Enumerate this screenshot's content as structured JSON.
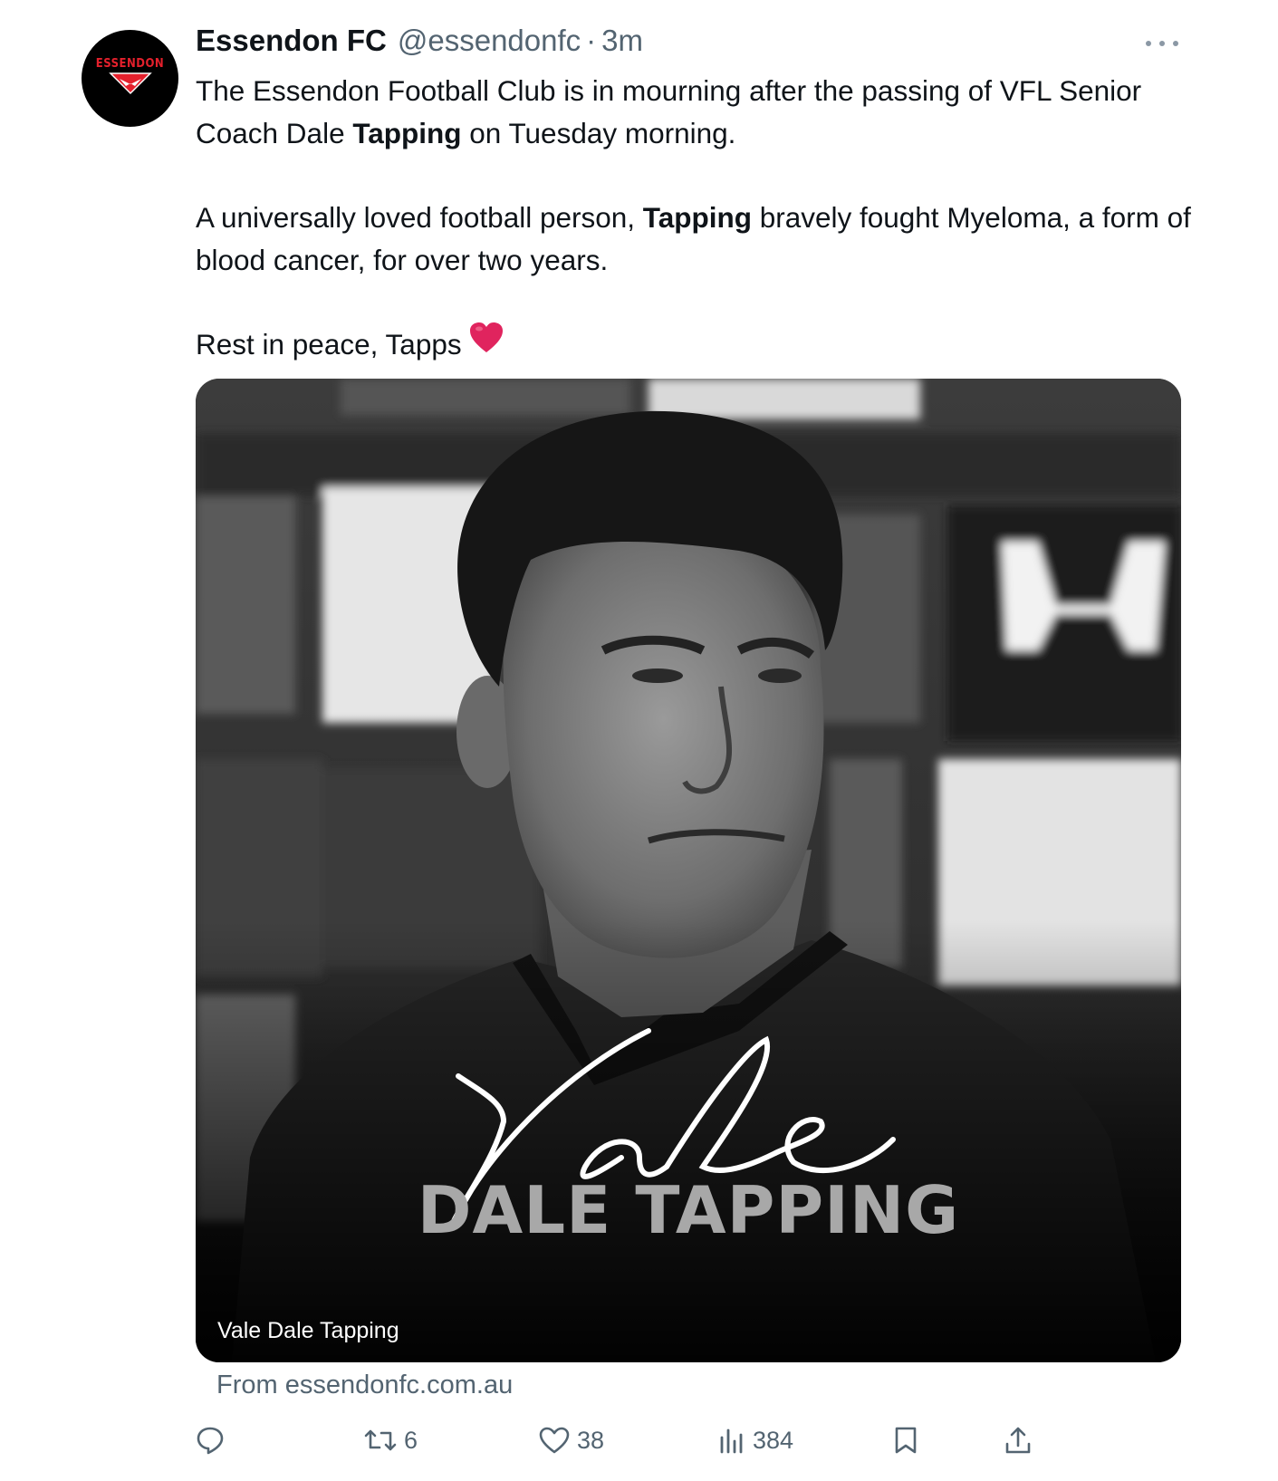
{
  "author": {
    "name": "Essendon FC",
    "handle": "@essendonfc",
    "separator": "·",
    "time": "3m",
    "avatar_text": "ESSENDON"
  },
  "tweet": {
    "p1_a": "The Essendon Football Club is in mourning after the passing of VFL Senior Coach Dale ",
    "p1_bold": "Tapping",
    "p1_b": " on Tuesday morning.",
    "p2_a": "A universally loved football person, ",
    "p2_bold": "Tapping",
    "p2_b": " bravely fought Myeloma, a form of blood cancer, for over two years.",
    "p3": "Rest in peace, Tapps",
    "emoji": "red-heart"
  },
  "card": {
    "script_word": "Vale",
    "title": "DALE TAPPING",
    "caption": "Vale Dale Tapping",
    "source": "From essendonfc.com.au"
  },
  "actions": {
    "replies": "",
    "reposts": "6",
    "likes": "38",
    "views": "384"
  },
  "colors": {
    "text": "#0f1419",
    "secondary": "#536471",
    "club_red": "#e4202c",
    "heart": "#e0245e"
  }
}
